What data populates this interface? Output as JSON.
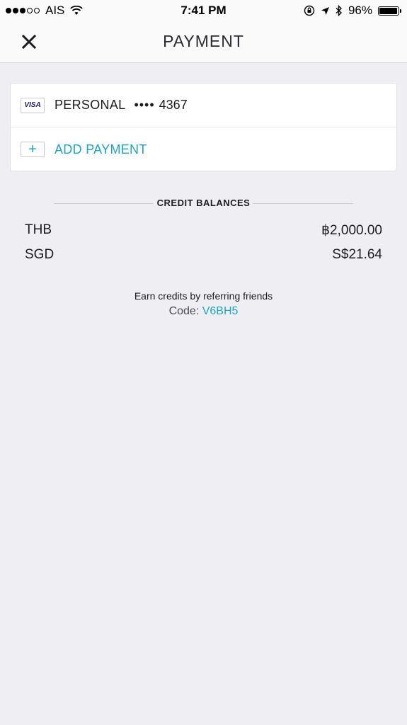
{
  "status_bar": {
    "carrier": "AIS",
    "time": "7:41 PM",
    "battery": "96%",
    "battery_level": 0.96,
    "signal_bars": 3
  },
  "nav": {
    "title": "PAYMENT",
    "close_icon": "close-icon"
  },
  "payment_methods": [
    {
      "brand": "VISA",
      "label": "PERSONAL",
      "masked": "••••",
      "last4": "4367"
    }
  ],
  "add_payment": {
    "label": "ADD PAYMENT",
    "icon": "plus-icon"
  },
  "credit_balances": {
    "title": "CREDIT BALANCES",
    "rows": [
      {
        "currency": "THB",
        "amount": "฿2,000.00"
      },
      {
        "currency": "SGD",
        "amount": "S$21.64"
      }
    ]
  },
  "referral": {
    "text": "Earn credits by referring friends",
    "code_label": "Code:",
    "code": "V6BH5"
  },
  "colors": {
    "accent": "#1fa4c4",
    "background": "#efeff3",
    "card": "#ffffff"
  }
}
